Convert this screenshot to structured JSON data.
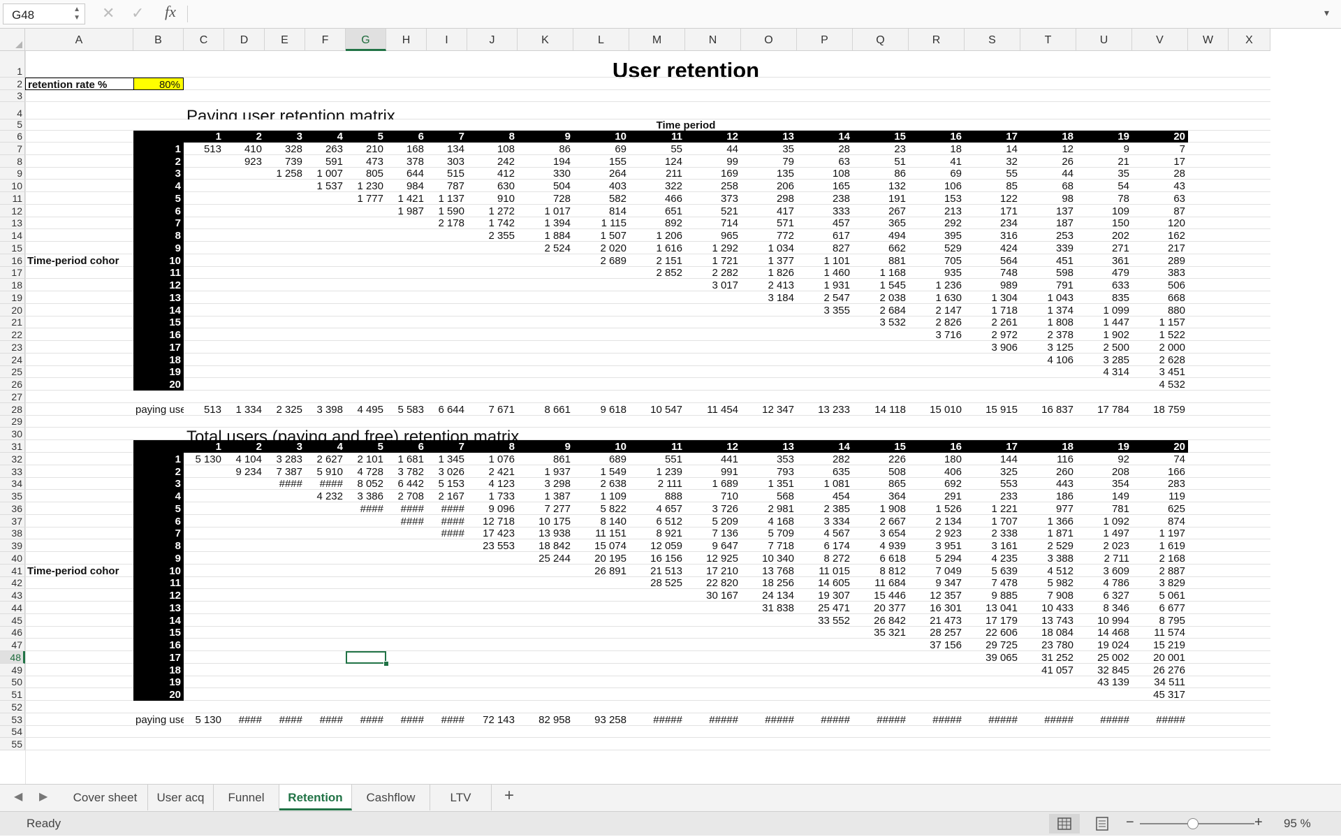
{
  "formula_bar": {
    "name_box": "G48",
    "formula": "",
    "fx_label": "fx"
  },
  "columns": [
    "A",
    "B",
    "C",
    "D",
    "E",
    "F",
    "G",
    "H",
    "I",
    "J",
    "K",
    "L",
    "M",
    "N",
    "O",
    "P",
    "Q",
    "R",
    "S",
    "T",
    "U",
    "V",
    "W",
    "X"
  ],
  "selected_cell": "G48",
  "rows_visible": [
    1,
    55
  ],
  "sheet": {
    "title": "User retention",
    "retention_label": "retention rate %",
    "retention_rate": "80%",
    "retention_rate_color": "#ffff00",
    "matrix1": {
      "heading": "Paying user retention matrix",
      "period_label": "Time period",
      "cohort_label": "Time-period cohor",
      "periods": [
        "1",
        "2",
        "3",
        "4",
        "5",
        "6",
        "7",
        "8",
        "9",
        "10",
        "11",
        "12",
        "13",
        "14",
        "15",
        "16",
        "17",
        "18",
        "19",
        "20"
      ],
      "cohorts": [
        "1",
        "2",
        "3",
        "4",
        "5",
        "6",
        "7",
        "8",
        "9",
        "10",
        "11",
        "12",
        "13",
        "14",
        "15",
        "16",
        "17",
        "18",
        "19",
        "20"
      ],
      "rows": [
        [
          "513",
          "410",
          "328",
          "263",
          "210",
          "168",
          "134",
          "108",
          "86",
          "69",
          "55",
          "44",
          "35",
          "28",
          "23",
          "18",
          "14",
          "12",
          "9",
          "7"
        ],
        [
          "",
          "923",
          "739",
          "591",
          "473",
          "378",
          "303",
          "242",
          "194",
          "155",
          "124",
          "99",
          "79",
          "63",
          "51",
          "41",
          "32",
          "26",
          "21",
          "17"
        ],
        [
          "",
          "",
          "1 258",
          "1 007",
          "805",
          "644",
          "515",
          "412",
          "330",
          "264",
          "211",
          "169",
          "135",
          "108",
          "86",
          "69",
          "55",
          "44",
          "35",
          "28"
        ],
        [
          "",
          "",
          "",
          "1 537",
          "1 230",
          "984",
          "787",
          "630",
          "504",
          "403",
          "322",
          "258",
          "206",
          "165",
          "132",
          "106",
          "85",
          "68",
          "54",
          "43"
        ],
        [
          "",
          "",
          "",
          "",
          "1 777",
          "1 421",
          "1 137",
          "910",
          "728",
          "582",
          "466",
          "373",
          "298",
          "238",
          "191",
          "153",
          "122",
          "98",
          "78",
          "63"
        ],
        [
          "",
          "",
          "",
          "",
          "",
          "1 987",
          "1 590",
          "1 272",
          "1 017",
          "814",
          "651",
          "521",
          "417",
          "333",
          "267",
          "213",
          "171",
          "137",
          "109",
          "87"
        ],
        [
          "",
          "",
          "",
          "",
          "",
          "",
          "2 178",
          "1 742",
          "1 394",
          "1 115",
          "892",
          "714",
          "571",
          "457",
          "365",
          "292",
          "234",
          "187",
          "150",
          "120"
        ],
        [
          "",
          "",
          "",
          "",
          "",
          "",
          "",
          "2 355",
          "1 884",
          "1 507",
          "1 206",
          "965",
          "772",
          "617",
          "494",
          "395",
          "316",
          "253",
          "202",
          "162"
        ],
        [
          "",
          "",
          "",
          "",
          "",
          "",
          "",
          "",
          "2 524",
          "2 020",
          "1 616",
          "1 292",
          "1 034",
          "827",
          "662",
          "529",
          "424",
          "339",
          "271",
          "217"
        ],
        [
          "",
          "",
          "",
          "",
          "",
          "",
          "",
          "",
          "",
          "2 689",
          "2 151",
          "1 721",
          "1 377",
          "1 101",
          "881",
          "705",
          "564",
          "451",
          "361",
          "289"
        ],
        [
          "",
          "",
          "",
          "",
          "",
          "",
          "",
          "",
          "",
          "",
          "2 852",
          "2 282",
          "1 826",
          "1 460",
          "1 168",
          "935",
          "748",
          "598",
          "479",
          "383"
        ],
        [
          "",
          "",
          "",
          "",
          "",
          "",
          "",
          "",
          "",
          "",
          "",
          "3 017",
          "2 413",
          "1 931",
          "1 545",
          "1 236",
          "989",
          "791",
          "633",
          "506"
        ],
        [
          "",
          "",
          "",
          "",
          "",
          "",
          "",
          "",
          "",
          "",
          "",
          "",
          "3 184",
          "2 547",
          "2 038",
          "1 630",
          "1 304",
          "1 043",
          "835",
          "668"
        ],
        [
          "",
          "",
          "",
          "",
          "",
          "",
          "",
          "",
          "",
          "",
          "",
          "",
          "",
          "3 355",
          "2 684",
          "2 147",
          "1 718",
          "1 374",
          "1 099",
          "880"
        ],
        [
          "",
          "",
          "",
          "",
          "",
          "",
          "",
          "",
          "",
          "",
          "",
          "",
          "",
          "",
          "3 532",
          "2 826",
          "2 261",
          "1 808",
          "1 447",
          "1 157"
        ],
        [
          "",
          "",
          "",
          "",
          "",
          "",
          "",
          "",
          "",
          "",
          "",
          "",
          "",
          "",
          "",
          "3 716",
          "2 972",
          "2 378",
          "1 902",
          "1 522"
        ],
        [
          "",
          "",
          "",
          "",
          "",
          "",
          "",
          "",
          "",
          "",
          "",
          "",
          "",
          "",
          "",
          "",
          "3 906",
          "3 125",
          "2 500",
          "2 000"
        ],
        [
          "",
          "",
          "",
          "",
          "",
          "",
          "",
          "",
          "",
          "",
          "",
          "",
          "",
          "",
          "",
          "",
          "",
          "4 106",
          "3 285",
          "2 628"
        ],
        [
          "",
          "",
          "",
          "",
          "",
          "",
          "",
          "",
          "",
          "",
          "",
          "",
          "",
          "",
          "",
          "",
          "",
          "",
          "4 314",
          "3 451"
        ],
        [
          "",
          "",
          "",
          "",
          "",
          "",
          "",
          "",
          "",
          "",
          "",
          "",
          "",
          "",
          "",
          "",
          "",
          "",
          "",
          "4 532"
        ]
      ],
      "total_label": "paying usei",
      "totals": [
        "513",
        "1 334",
        "2 325",
        "3 398",
        "4 495",
        "5 583",
        "6 644",
        "7 671",
        "8 661",
        "9 618",
        "10 547",
        "11 454",
        "12 347",
        "13 233",
        "14 118",
        "15 010",
        "15 915",
        "16 837",
        "17 784",
        "18 759"
      ]
    },
    "matrix2": {
      "heading": "Total users (paying and free) retention matrix",
      "cohort_label": "Time-period cohor",
      "periods": [
        "1",
        "2",
        "3",
        "4",
        "5",
        "6",
        "7",
        "8",
        "9",
        "10",
        "11",
        "12",
        "13",
        "14",
        "15",
        "16",
        "17",
        "18",
        "19",
        "20"
      ],
      "cohorts": [
        "1",
        "2",
        "3",
        "4",
        "5",
        "6",
        "7",
        "8",
        "9",
        "10",
        "11",
        "12",
        "13",
        "14",
        "15",
        "16",
        "17",
        "18",
        "19",
        "20"
      ],
      "rows": [
        [
          "5 130",
          "4 104",
          "3 283",
          "2 627",
          "2 101",
          "1 681",
          "1 345",
          "1 076",
          "861",
          "689",
          "551",
          "441",
          "353",
          "282",
          "226",
          "180",
          "144",
          "116",
          "92",
          "74"
        ],
        [
          "",
          "9 234",
          "7 387",
          "5 910",
          "4 728",
          "3 782",
          "3 026",
          "2 421",
          "1 937",
          "1 549",
          "1 239",
          "991",
          "793",
          "635",
          "508",
          "406",
          "325",
          "260",
          "208",
          "166"
        ],
        [
          "",
          "",
          "####",
          "####",
          "8 052",
          "6 442",
          "5 153",
          "4 123",
          "3 298",
          "2 638",
          "2 111",
          "1 689",
          "1 351",
          "1 081",
          "865",
          "692",
          "553",
          "443",
          "354",
          "283"
        ],
        [
          "",
          "",
          "",
          "4 232",
          "3 386",
          "2 708",
          "2 167",
          "1 733",
          "1 387",
          "1 109",
          "888",
          "710",
          "568",
          "454",
          "364",
          "291",
          "233",
          "186",
          "149",
          "119"
        ],
        [
          "",
          "",
          "",
          "",
          "####",
          "####",
          "####",
          "9 096",
          "7 277",
          "5 822",
          "4 657",
          "3 726",
          "2 981",
          "2 385",
          "1 908",
          "1 526",
          "1 221",
          "977",
          "781",
          "625"
        ],
        [
          "",
          "",
          "",
          "",
          "",
          "####",
          "####",
          "12 718",
          "10 175",
          "8 140",
          "6 512",
          "5 209",
          "4 168",
          "3 334",
          "2 667",
          "2 134",
          "1 707",
          "1 366",
          "1 092",
          "874"
        ],
        [
          "",
          "",
          "",
          "",
          "",
          "",
          "####",
          "17 423",
          "13 938",
          "11 151",
          "8 921",
          "7 136",
          "5 709",
          "4 567",
          "3 654",
          "2 923",
          "2 338",
          "1 871",
          "1 497",
          "1 197"
        ],
        [
          "",
          "",
          "",
          "",
          "",
          "",
          "",
          "23 553",
          "18 842",
          "15 074",
          "12 059",
          "9 647",
          "7 718",
          "6 174",
          "4 939",
          "3 951",
          "3 161",
          "2 529",
          "2 023",
          "1 619"
        ],
        [
          "",
          "",
          "",
          "",
          "",
          "",
          "",
          "",
          "25 244",
          "20 195",
          "16 156",
          "12 925",
          "10 340",
          "8 272",
          "6 618",
          "5 294",
          "4 235",
          "3 388",
          "2 711",
          "2 168"
        ],
        [
          "",
          "",
          "",
          "",
          "",
          "",
          "",
          "",
          "",
          "26 891",
          "21 513",
          "17 210",
          "13 768",
          "11 015",
          "8 812",
          "7 049",
          "5 639",
          "4 512",
          "3 609",
          "2 887"
        ],
        [
          "",
          "",
          "",
          "",
          "",
          "",
          "",
          "",
          "",
          "",
          "28 525",
          "22 820",
          "18 256",
          "14 605",
          "11 684",
          "9 347",
          "7 478",
          "5 982",
          "4 786",
          "3 829"
        ],
        [
          "",
          "",
          "",
          "",
          "",
          "",
          "",
          "",
          "",
          "",
          "",
          "30 167",
          "24 134",
          "19 307",
          "15 446",
          "12 357",
          "9 885",
          "7 908",
          "6 327",
          "5 061"
        ],
        [
          "",
          "",
          "",
          "",
          "",
          "",
          "",
          "",
          "",
          "",
          "",
          "",
          "31 838",
          "25 471",
          "20 377",
          "16 301",
          "13 041",
          "10 433",
          "8 346",
          "6 677"
        ],
        [
          "",
          "",
          "",
          "",
          "",
          "",
          "",
          "",
          "",
          "",
          "",
          "",
          "",
          "33 552",
          "26 842",
          "21 473",
          "17 179",
          "13 743",
          "10 994",
          "8 795"
        ],
        [
          "",
          "",
          "",
          "",
          "",
          "",
          "",
          "",
          "",
          "",
          "",
          "",
          "",
          "",
          "35 321",
          "28 257",
          "22 606",
          "18 084",
          "14 468",
          "11 574"
        ],
        [
          "",
          "",
          "",
          "",
          "",
          "",
          "",
          "",
          "",
          "",
          "",
          "",
          "",
          "",
          "",
          "37 156",
          "29 725",
          "23 780",
          "19 024",
          "15 219"
        ],
        [
          "",
          "",
          "",
          "",
          "",
          "",
          "",
          "",
          "",
          "",
          "",
          "",
          "",
          "",
          "",
          "",
          "39 065",
          "31 252",
          "25 002",
          "20 001"
        ],
        [
          "",
          "",
          "",
          "",
          "",
          "",
          "",
          "",
          "",
          "",
          "",
          "",
          "",
          "",
          "",
          "",
          "",
          "41 057",
          "32 845",
          "26 276"
        ],
        [
          "",
          "",
          "",
          "",
          "",
          "",
          "",
          "",
          "",
          "",
          "",
          "",
          "",
          "",
          "",
          "",
          "",
          "",
          "43 139",
          "34 511"
        ],
        [
          "",
          "",
          "",
          "",
          "",
          "",
          "",
          "",
          "",
          "",
          "",
          "",
          "",
          "",
          "",
          "",
          "",
          "",
          "",
          "45 317"
        ]
      ],
      "total_label": "paying usei",
      "totals": [
        "5 130",
        "####",
        "####",
        "####",
        "####",
        "####",
        "####",
        "72 143",
        "82 958",
        "93 258",
        "#####",
        "#####",
        "#####",
        "#####",
        "#####",
        "#####",
        "#####",
        "#####",
        "#####",
        "#####"
      ]
    }
  },
  "tabs": {
    "items": [
      {
        "label": "Cover sheet"
      },
      {
        "label": "User acq"
      },
      {
        "label": "Funnel"
      },
      {
        "label": "Retention"
      },
      {
        "label": "Cashflow"
      },
      {
        "label": "LTV"
      }
    ],
    "active": "Retention",
    "add": "+"
  },
  "status_bar": {
    "status": "Ready",
    "zoom_minus": "−",
    "zoom_plus": "+",
    "zoom": "95 %"
  },
  "colors": {
    "accent": "#217346",
    "matrix_header_bg": "#000000",
    "highlight": "#ffff00"
  },
  "icons": [
    "cancel-icon",
    "confirm-icon",
    "fx-icon",
    "tab-prev-icon",
    "tab-next-icon",
    "normal-view-icon",
    "page-layout-view-icon"
  ]
}
